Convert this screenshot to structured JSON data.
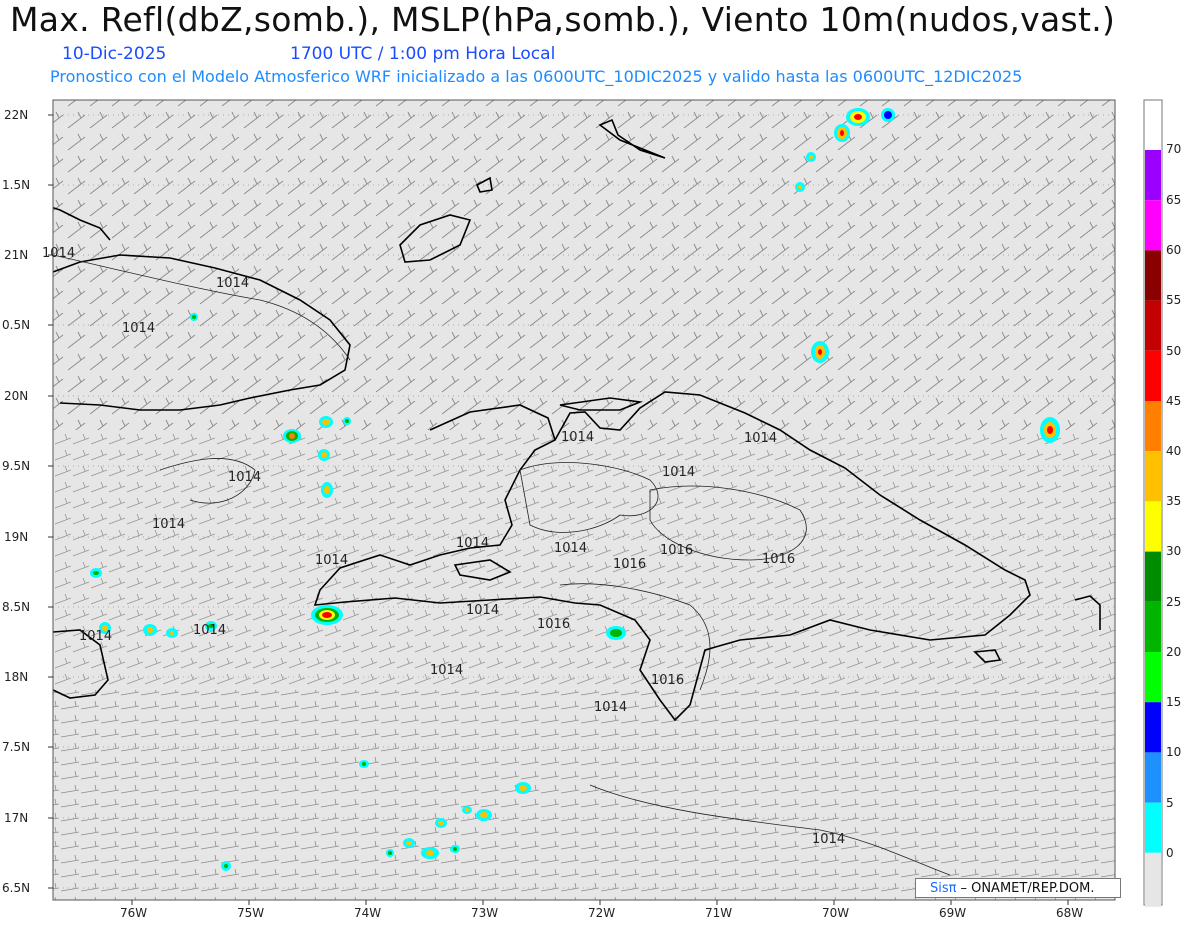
{
  "header": {
    "title": "Max. Refl(dbZ,somb.), MSLP(hPa,somb.), Viento 10m(nudos,vast.)",
    "date": "10-Dic-2025",
    "time": "1700 UTC / 1:00 pm Hora Local",
    "subtitle": "Pronostico con el Modelo Atmosferico WRF inicializado a las 0600UTC_10DIC2025 y valido hasta las  0600UTC_12DIC2025"
  },
  "axes": {
    "lat_labels": [
      "22N",
      "1.5N",
      "21N",
      "0.5N",
      "20N",
      "9.5N",
      "19N",
      "8.5N",
      "18N",
      "7.5N",
      "17N",
      "6.5N"
    ],
    "lon_labels": [
      "76W",
      "75W",
      "74W",
      "73W",
      "72W",
      "71W",
      "70W",
      "69W",
      "68W"
    ]
  },
  "colorbar": {
    "labels": [
      "70",
      "65",
      "60",
      "55",
      "50",
      "45",
      "40",
      "35",
      "30",
      "25",
      "20",
      "15",
      "10",
      "5",
      "0"
    ],
    "colors": [
      "#9b00ff",
      "#ff00ff",
      "#8a0000",
      "#c40000",
      "#ff0000",
      "#ff7f00",
      "#ffc000",
      "#ffff00",
      "#008c00",
      "#00b400",
      "#00ff00",
      "#0000ff",
      "#1e90ff",
      "#00ffff",
      "#e6e6e6"
    ]
  },
  "isobars": [
    {
      "text": "1014"
    },
    {
      "text": "1014"
    },
    {
      "text": "1014"
    },
    {
      "text": "1014"
    },
    {
      "text": "1014"
    },
    {
      "text": "1014"
    },
    {
      "text": "1014"
    },
    {
      "text": "1014"
    },
    {
      "text": "1014"
    },
    {
      "text": "1014"
    },
    {
      "text": "1014"
    },
    {
      "text": "1014"
    },
    {
      "text": "1014"
    },
    {
      "text": "1016"
    },
    {
      "text": "1016"
    },
    {
      "text": "1016"
    },
    {
      "text": "1016"
    },
    {
      "text": "1014"
    },
    {
      "text": "1016"
    },
    {
      "text": "1014"
    },
    {
      "text": "1014"
    },
    {
      "text": "1014"
    }
  ],
  "credit": {
    "sis": "Sisπ",
    "text": "– ONAMET/REP.DOM."
  }
}
